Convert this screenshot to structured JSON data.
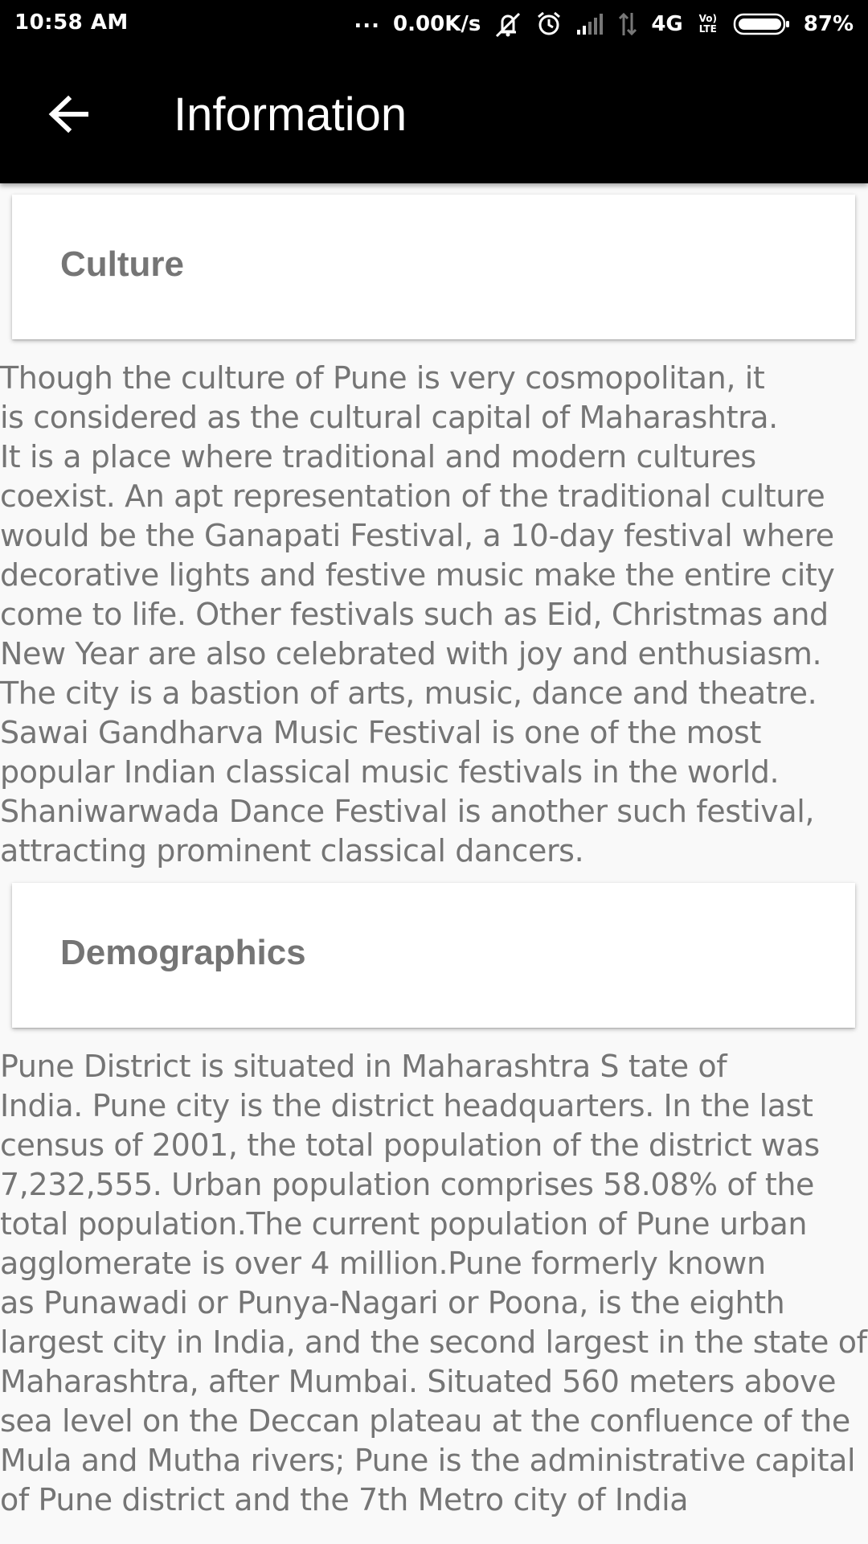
{
  "status_bar": {
    "time": "10:58 AM",
    "more": "...",
    "net_speed": "0.00K/s",
    "network_type": "4G",
    "volte": "Vo) LTE",
    "battery_percent": "87%",
    "icons": [
      "mute-vibrate-icon",
      "alarm-icon",
      "signal-icon",
      "data-arrows-icon",
      "volte-icon",
      "battery-icon"
    ]
  },
  "toolbar": {
    "title": "Information",
    "back_icon": "arrow-left-icon"
  },
  "sections": [
    {
      "title": "Culture",
      "lines": [
        "Though the culture of Pune is very cosmopolitan, it",
        "is considered as the cultural capital of Maharashtra.",
        "It is a place where traditional and modern cultures",
        "coexist. An apt representation of the traditional culture",
        "would be the Ganapati Festival, a 10-day festival where",
        "decorative lights and festive music make the entire city",
        "come to life. Other festivals such as Eid, Christmas and",
        "New Year are also celebrated with joy and enthusiasm.",
        "The city is a bastion of arts, music, dance and theatre.",
        "Sawai Gandharva Music Festival is one of the most",
        "popular Indian classical music festivals in the world.",
        "Shaniwarwada Dance Festival is another such festival,",
        "attracting prominent classical dancers."
      ]
    },
    {
      "title": "Demographics",
      "lines": [
        "Pune District is situated in Maharashtra S tate of",
        "India. Pune city is the district headquarters. In the last",
        "census of 2001, the total population of the district was",
        "7,232,555. Urban population comprises 58.08% of the",
        "total population.The current population of Pune urban",
        "agglomerate is over 4 million.Pune formerly known",
        "as Punawadi or Punya-Nagari or Poona, is the eighth",
        "largest city in India, and the second largest in the state of",
        "Maharashtra, after Mumbai. Situated 560 meters above",
        "sea level on the Deccan plateau at the confluence of the",
        "Mula and Mutha rivers; Pune is the administrative capital",
        "of Pune district and the 7th Metro city of India"
      ]
    }
  ],
  "colors": {
    "app_bar": "#000000",
    "background": "#f9f9f9",
    "card": "#ffffff",
    "text": "#757575"
  }
}
